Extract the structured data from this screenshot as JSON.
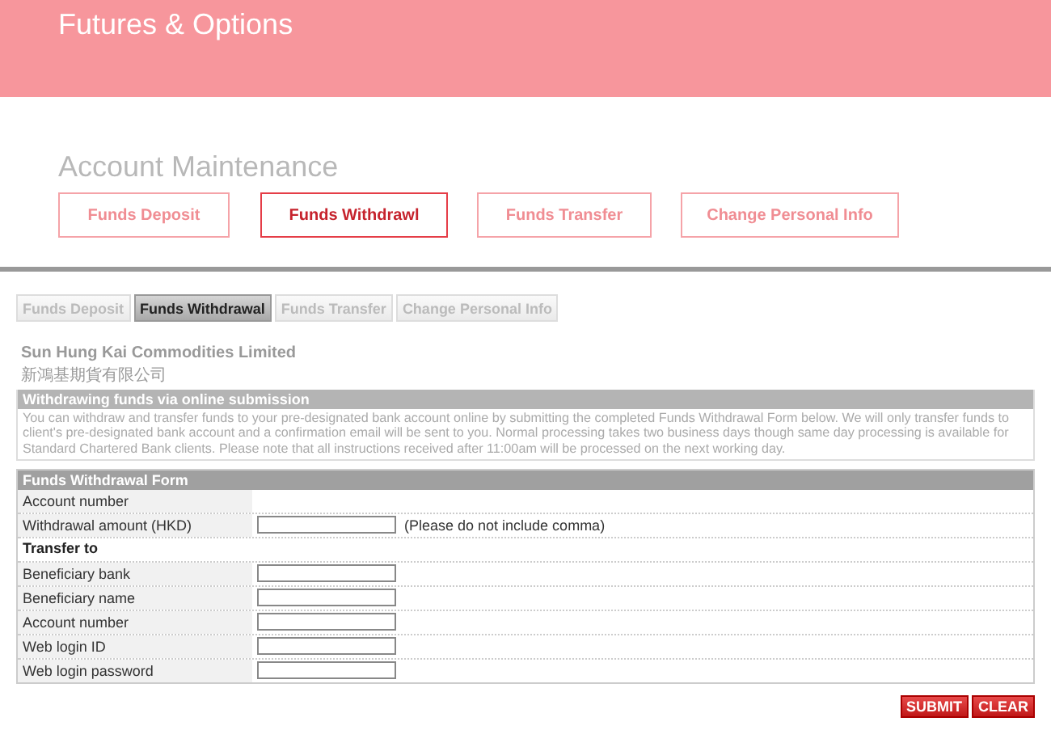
{
  "header": {
    "title": "Futures & Options"
  },
  "section_title": "Account Maintenance",
  "top_buttons": [
    {
      "label": "Funds Deposit",
      "selected": false
    },
    {
      "label": "Funds Withdrawl",
      "selected": true
    },
    {
      "label": "Funds Transfer",
      "selected": false
    },
    {
      "label": "Change Personal Info",
      "selected": false
    }
  ],
  "tabs": [
    {
      "label": "Funds Deposit",
      "selected": false
    },
    {
      "label": "Funds Withdrawal",
      "selected": true
    },
    {
      "label": "Funds Transfer",
      "selected": false
    },
    {
      "label": "Change Personal Info",
      "selected": false
    }
  ],
  "company": {
    "name": "Sun Hung Kai Commodities Limited",
    "name_zh": "新鴻基期貨有限公司"
  },
  "info": {
    "heading": "Withdrawing funds via online submission",
    "text": "You can withdraw and transfer funds to your pre-designated bank account online by submitting the completed Funds Withdrawal Form below. We will only transfer funds to client's pre-designated bank account and a confirmation email will be sent to you. Normal processing takes two business days though same day processing is available for Standard Chartered Bank clients. Please note that all instructions received after 11:00am will be processed on the next working day."
  },
  "form": {
    "heading": "Funds Withdrawal Form",
    "rows": [
      {
        "kind": "field",
        "label": "Account number",
        "input": false
      },
      {
        "kind": "field",
        "label": "Withdrawal amount (HKD)",
        "input": true,
        "note": "(Please do not include comma)"
      },
      {
        "kind": "section",
        "label": "Transfer to"
      },
      {
        "kind": "field",
        "label": "Beneficiary bank",
        "input": true
      },
      {
        "kind": "field",
        "label": "Beneficiary name",
        "input": true
      },
      {
        "kind": "field",
        "label": "Account number",
        "input": true
      },
      {
        "kind": "field",
        "label": "Web login ID",
        "input": true
      },
      {
        "kind": "field",
        "label": "Web login password",
        "input": true
      }
    ]
  },
  "actions": [
    "SUBMIT",
    "CLEAR"
  ]
}
